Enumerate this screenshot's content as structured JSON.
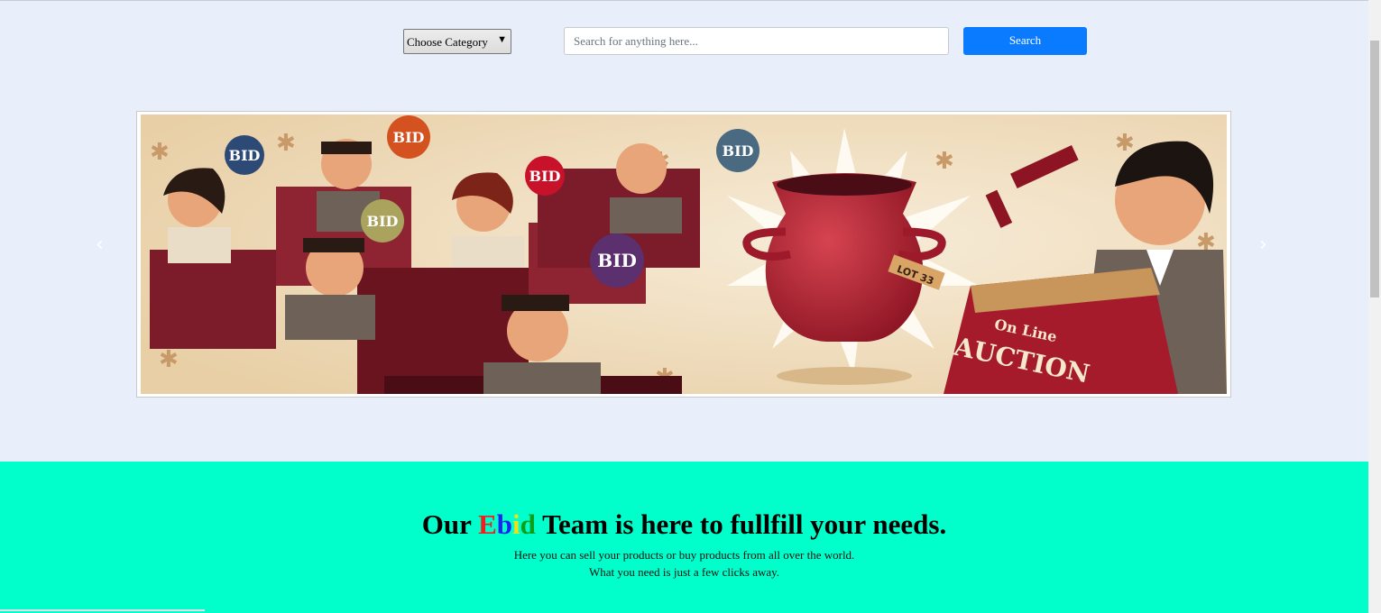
{
  "search": {
    "category_selected": "Choose Category",
    "placeholder": "Search for anything here...",
    "button_label": "Search"
  },
  "carousel": {
    "image_description_icon": "online-auction-illustration",
    "sign_paddle_text": "BID",
    "lot_tag_text": "LOT 33",
    "podium_line1": "On Line",
    "podium_line2": "AUCTION",
    "prev_icon": "chevron-left-icon",
    "next_icon": "chevron-right-icon",
    "prev_glyph": "‹",
    "next_glyph": "›"
  },
  "info": {
    "headline_prefix": "Our ",
    "brand_letters": [
      "E",
      "b",
      "i",
      "d"
    ],
    "headline_suffix": " Team is here to fullfill your needs.",
    "line1": "Here you can sell your products or buy products from all over the world.",
    "line2": "What you need is just a few clicks away."
  },
  "colors": {
    "page_background": "#e8eefa",
    "band_background": "#00ffca",
    "search_button": "#0a7bff",
    "brand_e": "#ef2020",
    "brand_b": "#1a26ef",
    "brand_i": "#f0e01a",
    "brand_d": "#0aa01a"
  }
}
